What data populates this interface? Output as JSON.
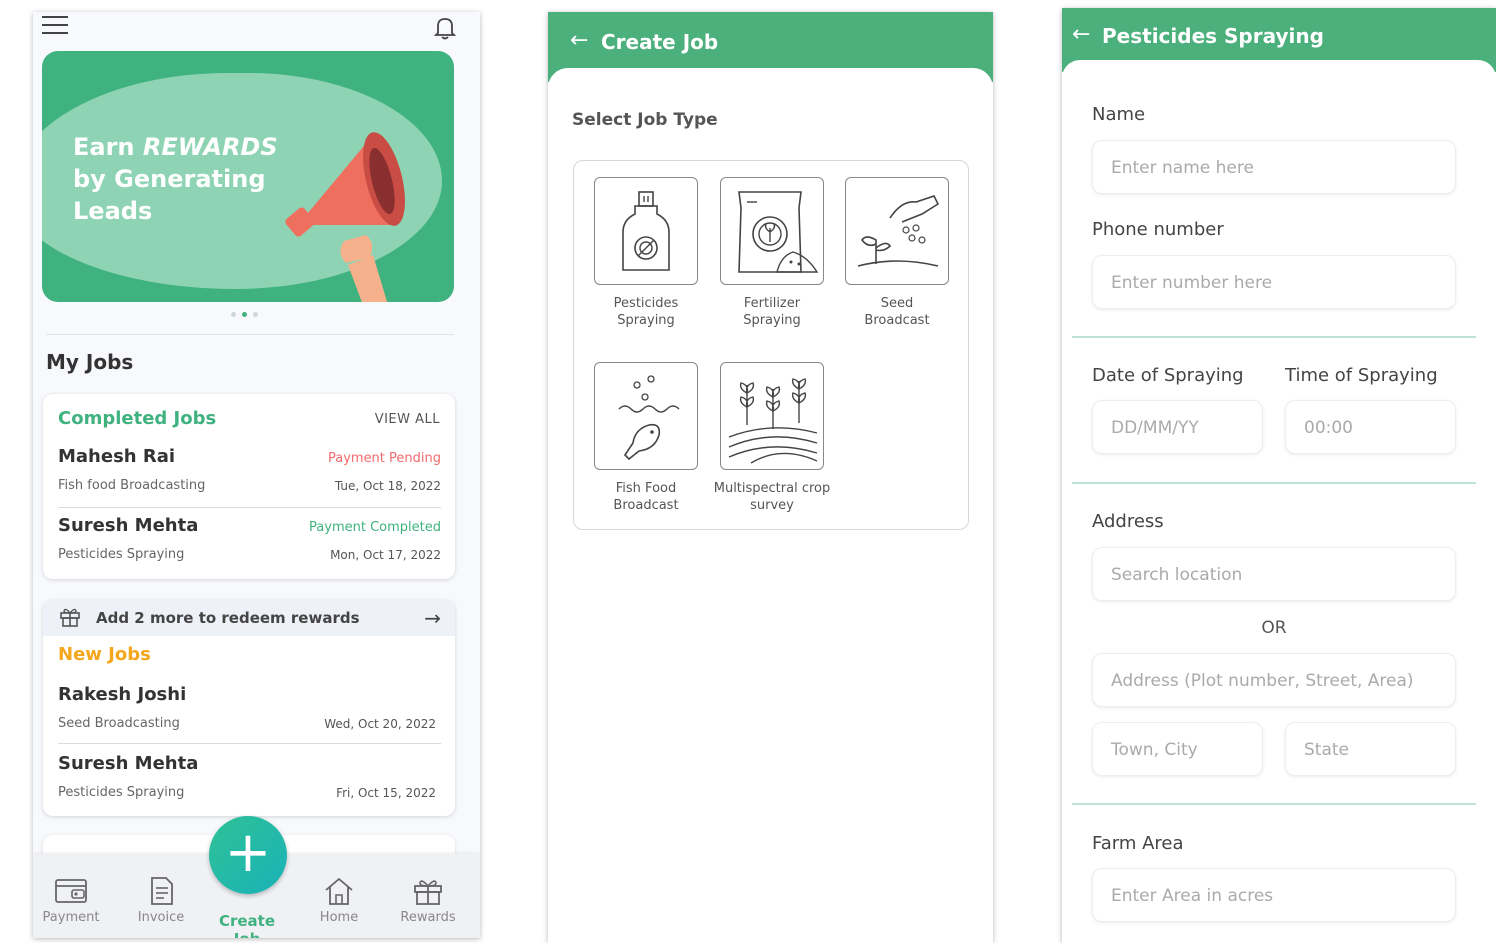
{
  "home": {
    "banner": {
      "line1_prefix": "Earn",
      "line1_em": "REWARDS",
      "line2": "by Generating",
      "line3": "Leads"
    },
    "my_jobs_title": "My Jobs",
    "completed": {
      "title": "Completed Jobs",
      "view_all": "VIEW ALL",
      "rows": [
        {
          "name": "Mahesh Rai",
          "type": "Fish food Broadcasting",
          "status": "Payment Pending",
          "date": "Tue, Oct 18, 2022"
        },
        {
          "name": "Suresh Mehta",
          "type": "Pesticides Spraying",
          "status": "Payment Completed",
          "date": "Mon, Oct 17, 2022"
        }
      ]
    },
    "redeem_text": "Add 2 more to redeem rewards",
    "new_jobs": {
      "title": "New Jobs",
      "rows": [
        {
          "name": "Rakesh Joshi",
          "type": "Seed Broadcasting",
          "date": "Wed, Oct 20, 2022"
        },
        {
          "name": "Suresh Mehta",
          "type": "Pesticides Spraying",
          "date": "Fri, Oct 15, 2022"
        }
      ]
    },
    "nav": [
      {
        "label": "Payment",
        "icon": "payment-icon"
      },
      {
        "label": "Invoice",
        "icon": "invoice-icon"
      },
      {
        "label": "Create Job",
        "icon": "plus-icon"
      },
      {
        "label": "Home",
        "icon": "home-icon"
      },
      {
        "label": "Rewards",
        "icon": "gift-icon"
      }
    ]
  },
  "create_job": {
    "title": "Create Job",
    "select_label": "Select Job Type",
    "types": [
      {
        "line1": "Pesticides",
        "line2": "Spraying",
        "icon": "pesticide-bottle-icon"
      },
      {
        "line1": "Fertilizer",
        "line2": "Spraying",
        "icon": "fertilizer-bag-icon"
      },
      {
        "line1": "Seed",
        "line2": "Broadcast",
        "icon": "seed-hand-icon"
      },
      {
        "line1": "Fish Food",
        "line2": "Broadcast",
        "icon": "fish-icon"
      },
      {
        "line1": "Multispectral crop",
        "line2": "survey",
        "icon": "crop-field-icon"
      }
    ]
  },
  "form": {
    "title": "Pesticides Spraying",
    "name_label": "Name",
    "name_placeholder": "Enter name here",
    "phone_label": "Phone number",
    "phone_placeholder": "Enter number here",
    "date_label": "Date of Spraying",
    "date_placeholder": "DD/MM/YY",
    "time_label": "Time of Spraying",
    "time_placeholder": "00:00",
    "address_label": "Address",
    "search_placeholder": "Search location",
    "or_text": "OR",
    "address_placeholder": "Address (Plot number, Street, Area)",
    "town_placeholder": "Town, City",
    "state_placeholder": "State",
    "farm_label": "Farm Area",
    "farm_placeholder": "Enter Area in acres"
  },
  "colors": {
    "brand_green": "#4bb07c",
    "pending_red": "#f26b6b",
    "new_jobs_orange": "#f4a71d"
  }
}
